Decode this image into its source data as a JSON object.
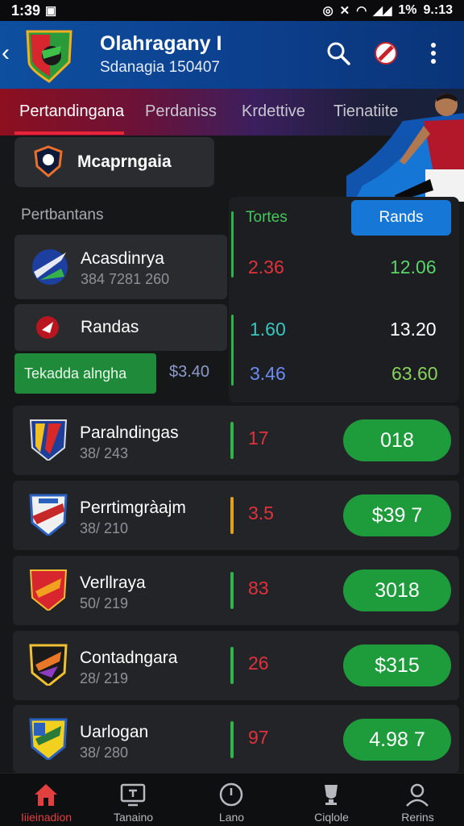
{
  "status_bar": {
    "time": "1:39",
    "battery": "1%",
    "clock": "9.:13"
  },
  "header": {
    "title": "Olahragany I",
    "subtitle": "Sdanagia 150407"
  },
  "tabs": [
    {
      "label": "Pertandingana",
      "active": true
    },
    {
      "label": "Perdaniss",
      "active": false
    },
    {
      "label": "Krdettive",
      "active": false
    },
    {
      "label": "Tienatiite",
      "active": false
    }
  ],
  "league": {
    "label": "Mcaprngaia"
  },
  "section_label": "Pertbantans",
  "odds_panel": {
    "totals_header": "Tortes",
    "rands_header": "Rands",
    "rows": [
      {
        "left": "2.36",
        "right": "12.06"
      },
      {
        "left": "1.60",
        "right": "13.20"
      },
      {
        "left": "3.46",
        "right": "63.60"
      }
    ]
  },
  "top_matches": [
    {
      "name": "Acasdinrya",
      "meta": "384 7281 260"
    },
    {
      "name": "Randas",
      "meta": ""
    }
  ],
  "bet_bar": {
    "label": "Tekadda alngha",
    "amount": "$3.40"
  },
  "matches": [
    {
      "name": "Paralndingas",
      "meta": "38/ 243",
      "odd": "17",
      "pill": "018",
      "bar": "#2fb34a"
    },
    {
      "name": "Perrtimgràajm",
      "meta": "38/ 210",
      "odd": "3.5",
      "pill": "$39 7",
      "bar": "#e0a020"
    },
    {
      "name": "Verllraya",
      "meta": "50/ 219",
      "odd": "83",
      "pill": "3018",
      "bar": "#2fb34a"
    },
    {
      "name": "Contadngara",
      "meta": "28/ 219",
      "odd": "26",
      "pill": "$315",
      "bar": "#2fb34a"
    },
    {
      "name": "Uarlogan",
      "meta": "38/ 280",
      "odd": "97",
      "pill": "4.98 7",
      "bar": "#2fb34a"
    }
  ],
  "bottom_nav": [
    {
      "label": "Iiieinadion",
      "icon": "home-icon",
      "active": true
    },
    {
      "label": "Tanaino",
      "icon": "tv-icon",
      "active": false
    },
    {
      "label": "Lano",
      "icon": "clock-icon",
      "active": false
    },
    {
      "label": "Ciqlole",
      "icon": "trophy-icon",
      "active": false
    },
    {
      "label": "Rerins",
      "icon": "profile-icon",
      "active": false
    }
  ],
  "colors": {
    "accent_red": "#e8243a",
    "header_blue": "#0e4fa0",
    "odds_green": "#1e9c3c",
    "rands_blue": "#1677d6"
  }
}
